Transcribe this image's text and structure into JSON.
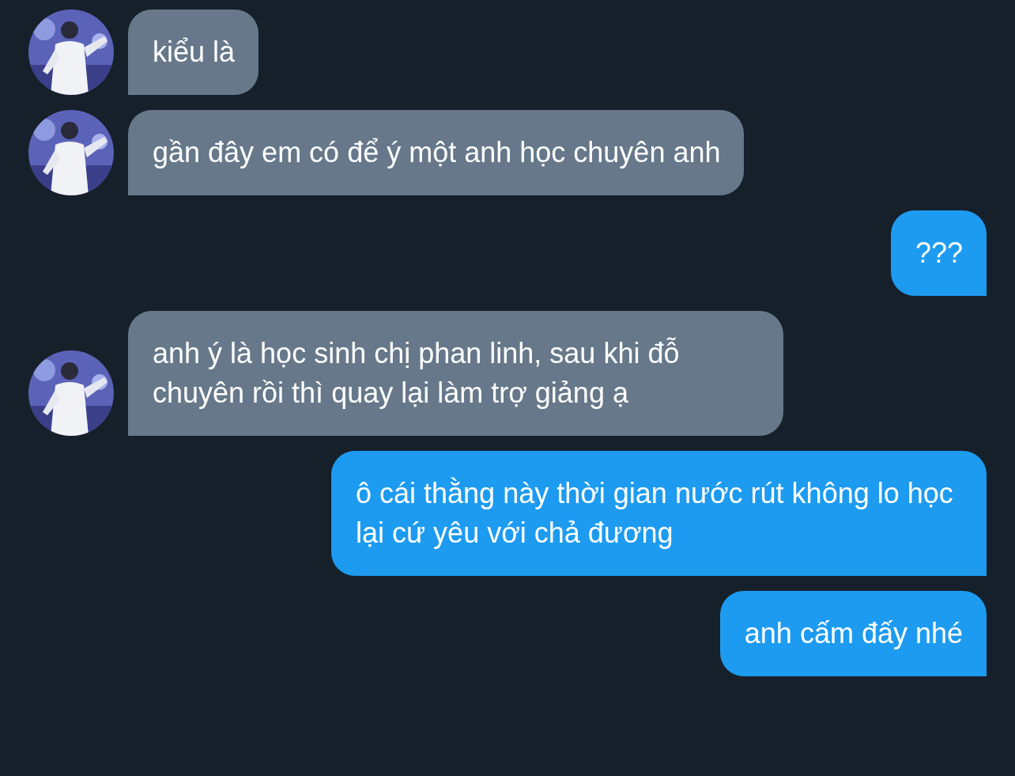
{
  "messages": [
    {
      "kind": "incoming",
      "text": "kiểu là"
    },
    {
      "kind": "incoming",
      "text": "gần đây em có để ý một anh học chuyên anh"
    },
    {
      "kind": "outgoing",
      "text": "???"
    },
    {
      "kind": "incoming",
      "text": "anh ý là học sinh chị phan linh, sau khi đỗ chuyên rồi thì quay lại làm trợ giảng ạ"
    },
    {
      "kind": "outgoing",
      "text": "ô cái thằng này thời gian nước rút không lo học lại cứ yêu với chả đương"
    },
    {
      "kind": "outgoing",
      "text": "anh cấm đấy nhé"
    }
  ]
}
